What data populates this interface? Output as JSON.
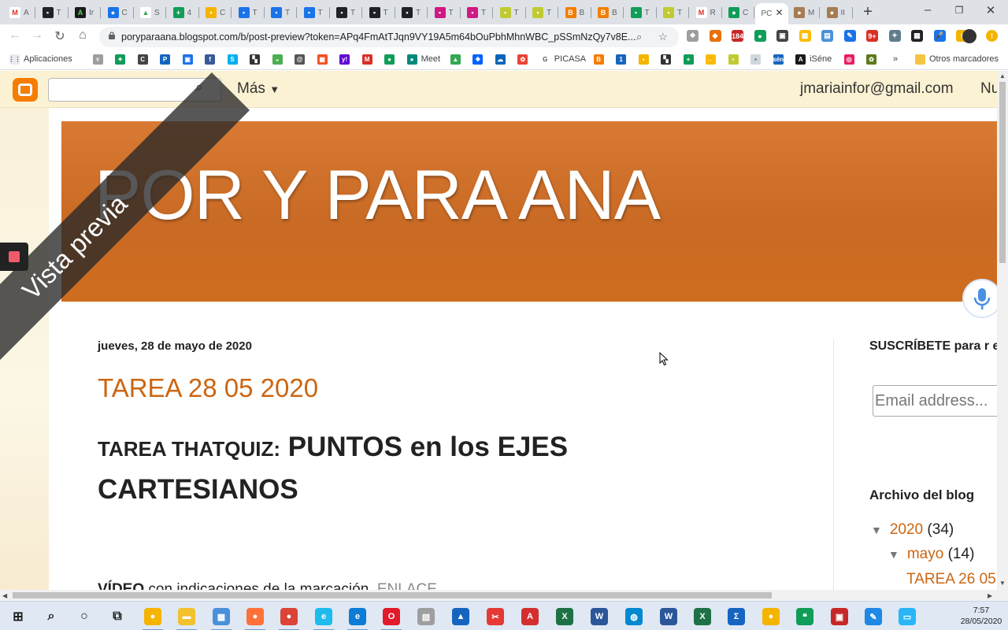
{
  "browser": {
    "tabs": [
      {
        "letter": "M",
        "title": "A",
        "color": "#ffffff",
        "fg": "#d93025"
      },
      {
        "letter": "▪",
        "title": "T",
        "color": "#202124",
        "fg": "#ffffff"
      },
      {
        "letter": "A",
        "title": "Ir",
        "color": "#1a1a1a",
        "fg": "#5fd35f"
      },
      {
        "letter": "●",
        "title": "C",
        "color": "#1a73e8",
        "fg": "#ffffff"
      },
      {
        "letter": "▲",
        "title": "S",
        "color": "#ffffff",
        "fg": "#34a853"
      },
      {
        "letter": "+",
        "title": "4",
        "color": "#0f9d58",
        "fg": "#ffffff"
      },
      {
        "letter": "▪",
        "title": "C",
        "color": "#f4b400",
        "fg": "#ffffff"
      },
      {
        "letter": "▪",
        "title": "T",
        "color": "#1a73e8",
        "fg": "#ffffff"
      },
      {
        "letter": "▪",
        "title": "T",
        "color": "#1a73e8",
        "fg": "#ffffff"
      },
      {
        "letter": "▪",
        "title": "T",
        "color": "#1a73e8",
        "fg": "#ffffff"
      },
      {
        "letter": "▪",
        "title": "T",
        "color": "#202124",
        "fg": "#ffffff"
      },
      {
        "letter": "▪",
        "title": "T",
        "color": "#202124",
        "fg": "#ffffff"
      },
      {
        "letter": "▪",
        "title": "T",
        "color": "#202124",
        "fg": "#ffffff"
      },
      {
        "letter": "▪",
        "title": "T",
        "color": "#d01884",
        "fg": "#ffffff"
      },
      {
        "letter": "▪",
        "title": "T",
        "color": "#d01884",
        "fg": "#ffffff"
      },
      {
        "letter": "▪",
        "title": "T",
        "color": "#c0ca33",
        "fg": "#ffffff"
      },
      {
        "letter": "▪",
        "title": "T",
        "color": "#c0ca33",
        "fg": "#ffffff"
      },
      {
        "letter": "B",
        "title": "B",
        "color": "#f57d00",
        "fg": "#ffffff"
      },
      {
        "letter": "B",
        "title": "B",
        "color": "#f57d00",
        "fg": "#ffffff"
      },
      {
        "letter": "▪",
        "title": "T",
        "color": "#0f9d58",
        "fg": "#ffffff"
      },
      {
        "letter": "▪",
        "title": "T",
        "color": "#c0ca33",
        "fg": "#ffffff"
      },
      {
        "letter": "M",
        "title": "R",
        "color": "#ffffff",
        "fg": "#d93025"
      },
      {
        "letter": "●",
        "title": "C",
        "color": "#0f9d58",
        "fg": "#ffffff"
      },
      {
        "letter": "",
        "title": "PC",
        "color": "#ffffff",
        "fg": "#ffffff",
        "active": true
      },
      {
        "letter": "●",
        "title": "M",
        "color": "#a67c52",
        "fg": "#ffffff"
      },
      {
        "letter": "●",
        "title": "II",
        "color": "#a67c52",
        "fg": "#ffffff"
      }
    ],
    "new_tab": "+",
    "url": "poryparaana.blogspot.com/b/post-preview?token=APq4FmAtTJqn9VY19A5m64bOuPbhMhnWBC_pSSmNzQy7v8E...",
    "bookmarks": [
      {
        "label": "Aplicaciones",
        "color": "#e8eaed",
        "glyph": "⋮⋮"
      },
      {
        "label": "",
        "color": "#9e9e9e",
        "glyph": "ʏ"
      },
      {
        "label": "",
        "color": "#0f9d58",
        "glyph": "✦"
      },
      {
        "label": "",
        "color": "#444444",
        "glyph": "C"
      },
      {
        "label": "",
        "color": "#1565c0",
        "glyph": "P"
      },
      {
        "label": "",
        "color": "#1a73e8",
        "glyph": "▣"
      },
      {
        "label": "",
        "color": "#3b5998",
        "glyph": "f"
      },
      {
        "label": "",
        "color": "#00aff0",
        "glyph": "S"
      },
      {
        "label": "",
        "color": "#333333",
        "glyph": "▚"
      },
      {
        "label": "",
        "color": "#4caf50",
        "glyph": "◒"
      },
      {
        "label": "",
        "color": "#555555",
        "glyph": "@"
      },
      {
        "label": "",
        "color": "#f25022",
        "glyph": "▦"
      },
      {
        "label": "",
        "color": "#6001d2",
        "glyph": "y!"
      },
      {
        "label": "",
        "color": "#d93025",
        "glyph": "M"
      },
      {
        "label": "",
        "color": "#0f9d58",
        "glyph": "●"
      },
      {
        "label": "Meet",
        "color": "#00897b",
        "glyph": "●"
      },
      {
        "label": "",
        "color": "#34a853",
        "glyph": "▲"
      },
      {
        "label": "",
        "color": "#0061ff",
        "glyph": "❖"
      },
      {
        "label": "",
        "color": "#0364b8",
        "glyph": "☁"
      },
      {
        "label": "",
        "color": "#ea4335",
        "glyph": "✿"
      },
      {
        "label": "PICASA",
        "color": "#ffffff",
        "glyph": "G"
      },
      {
        "label": "",
        "color": "#f57d00",
        "glyph": "B"
      },
      {
        "label": "",
        "color": "#1565c0",
        "glyph": "1"
      },
      {
        "label": "",
        "color": "#f4b400",
        "glyph": "▪"
      },
      {
        "label": "",
        "color": "#333333",
        "glyph": "▚"
      },
      {
        "label": "",
        "color": "#0f9d58",
        "glyph": "+"
      },
      {
        "label": "",
        "color": "#fbbc04",
        "glyph": "✋"
      },
      {
        "label": "",
        "color": "#c0ca33",
        "glyph": "▪"
      },
      {
        "label": "",
        "color": "#cfd8dc",
        "glyph": "▪"
      },
      {
        "label": "",
        "color": "#1565c0",
        "glyph": "sén"
      },
      {
        "label": "iSéne",
        "color": "#1a1a1a",
        "glyph": "A"
      },
      {
        "label": "",
        "color": "#e91e63",
        "glyph": "◎"
      },
      {
        "label": "",
        "color": "#5d7a1a",
        "glyph": "✿"
      }
    ],
    "bookmarks_more": "»",
    "other_bookmarks": "Otros marcadores"
  },
  "blogger_nav": {
    "more_label": "Más",
    "email": "jmariainfor@gmail.com",
    "next_label": "Nu"
  },
  "blog": {
    "title": "POR Y PARA ANA",
    "ribbon": "Vista previa",
    "post": {
      "date": "jueves, 28 de mayo de 2020",
      "title": "TAREA 28 05 2020",
      "heading_small": "TAREA THATQUIZ:",
      "heading_big": "PUNTOS en los EJES CARTESIANOS",
      "video_bold": "VÍDEO",
      "video_text": "con indicaciones de la marcación.",
      "link": "ENLACE"
    },
    "sidebar": {
      "subscribe": "SUSCRÍBETE para r en tu Email",
      "email_placeholder": "Email address...",
      "archive_title": "Archivo del blog",
      "year": "2020",
      "year_count": "(34)",
      "month": "mayo",
      "month_count": "(14)",
      "post_item": "TAREA 26 05"
    }
  },
  "taskbar": {
    "time": "7:57",
    "date": "28/05/2020",
    "apps": [
      {
        "name": "windows-start",
        "color": "#1c1c1c",
        "glyph": "⊞"
      },
      {
        "name": "search",
        "color": "#1c1c1c",
        "glyph": "⌕"
      },
      {
        "name": "cortana",
        "color": "#1c1c1c",
        "glyph": "○"
      },
      {
        "name": "task-view",
        "color": "#1c1c1c",
        "glyph": "⧉"
      },
      {
        "name": "chrome-canary",
        "color": "#f4b400",
        "glyph": "●"
      },
      {
        "name": "file-explorer",
        "color": "#f2c12e",
        "glyph": "▬"
      },
      {
        "name": "app-blue",
        "color": "#4a90d9",
        "glyph": "▦"
      },
      {
        "name": "firefox",
        "color": "#ff7139",
        "glyph": "●"
      },
      {
        "name": "chrome",
        "color": "#db4437",
        "glyph": "●"
      },
      {
        "name": "ie",
        "color": "#1ebbee",
        "glyph": "e"
      },
      {
        "name": "edge",
        "color": "#0c7cd5",
        "glyph": "e"
      },
      {
        "name": "opera",
        "color": "#e11a2c",
        "glyph": "O"
      },
      {
        "name": "app-gray",
        "color": "#9e9e9e",
        "glyph": "▤"
      },
      {
        "name": "app-blue2",
        "color": "#1565c0",
        "glyph": "▲"
      },
      {
        "name": "app-snip",
        "color": "#e53935",
        "glyph": "✂"
      },
      {
        "name": "acrobat",
        "color": "#d32f2f",
        "glyph": "A"
      },
      {
        "name": "excel",
        "color": "#1e7145",
        "glyph": "X"
      },
      {
        "name": "word",
        "color": "#2b579a",
        "glyph": "W"
      },
      {
        "name": "app-globe",
        "color": "#0288d1",
        "glyph": "◍"
      },
      {
        "name": "word-old",
        "color": "#2b579a",
        "glyph": "W"
      },
      {
        "name": "excel-old",
        "color": "#1e7145",
        "glyph": "X"
      },
      {
        "name": "app-sigma",
        "color": "#1565c0",
        "glyph": "Σ"
      },
      {
        "name": "app-chrome-old",
        "color": "#f4b400",
        "glyph": "●"
      },
      {
        "name": "hangouts",
        "color": "#0f9d58",
        "glyph": "❝"
      },
      {
        "name": "app-red",
        "color": "#c62828",
        "glyph": "▣"
      },
      {
        "name": "app-notepad",
        "color": "#1e88e5",
        "glyph": "✎"
      },
      {
        "name": "app-screen",
        "color": "#29b6f6",
        "glyph": "▭"
      }
    ]
  }
}
